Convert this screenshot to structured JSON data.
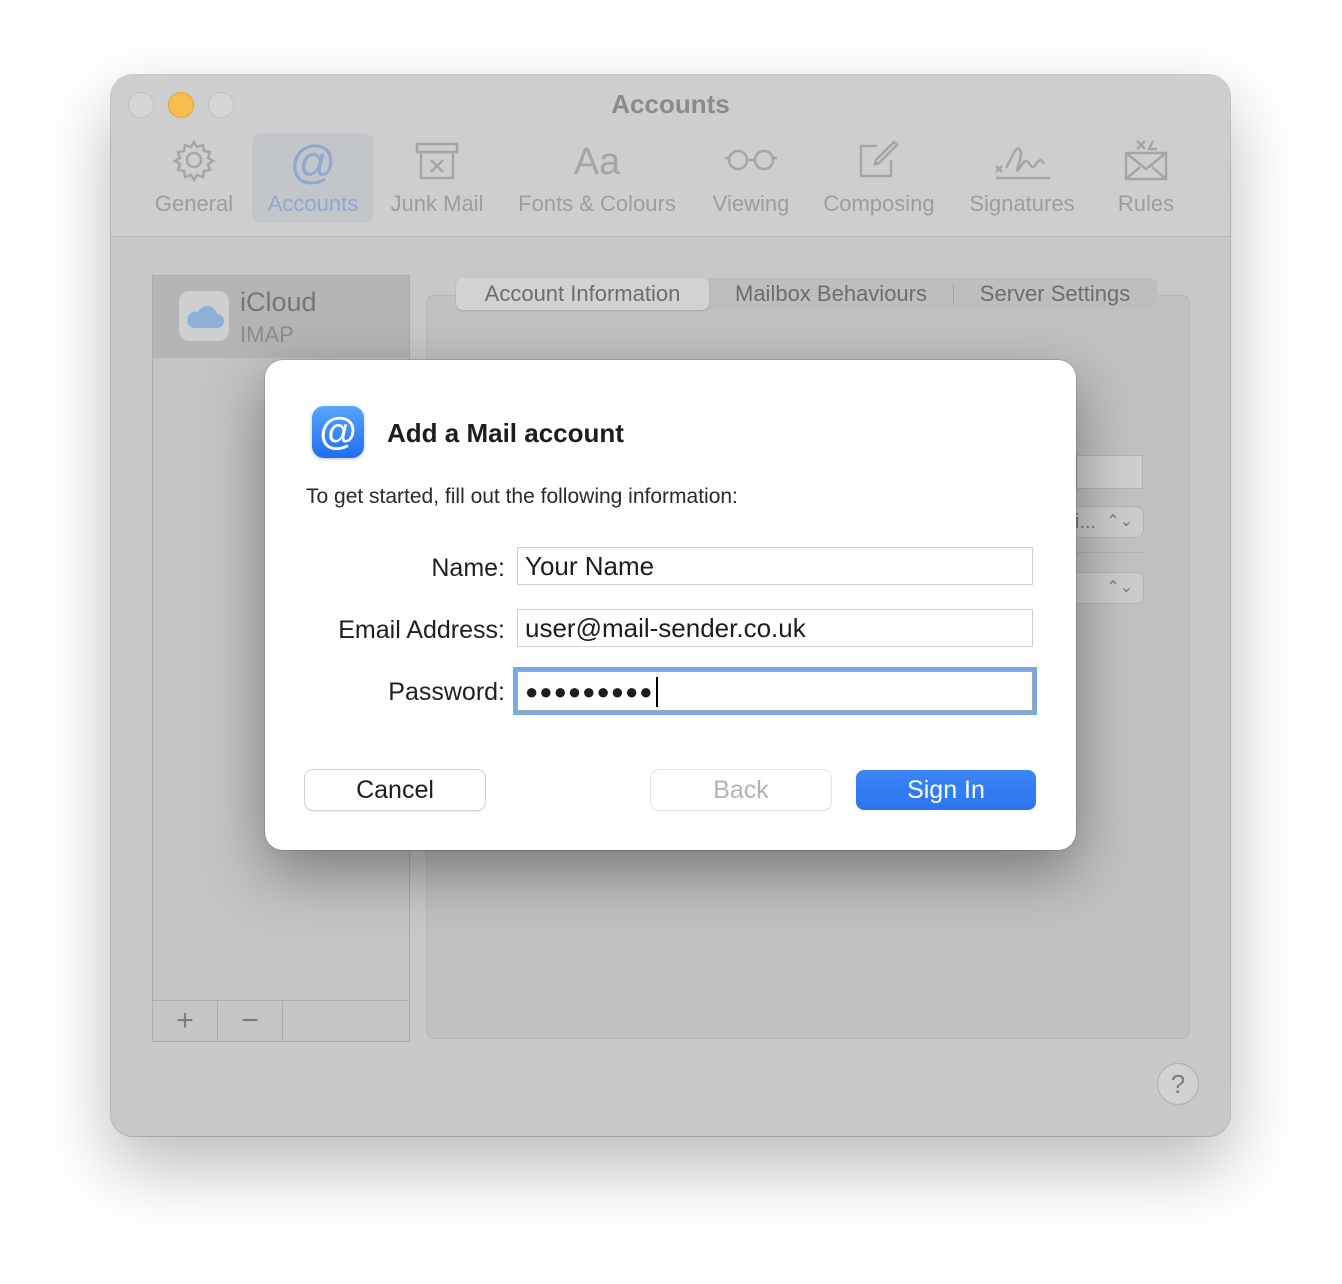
{
  "window": {
    "title": "Accounts"
  },
  "toolbar": {
    "items": [
      {
        "label": "General",
        "icon": "gear-icon"
      },
      {
        "label": "Accounts",
        "icon": "at-icon",
        "active": true
      },
      {
        "label": "Junk Mail",
        "icon": "junk-mail-icon"
      },
      {
        "label": "Fonts & Colours",
        "icon": "fonts-icon",
        "glyph": "Aa"
      },
      {
        "label": "Viewing",
        "icon": "glasses-icon"
      },
      {
        "label": "Composing",
        "icon": "compose-icon"
      },
      {
        "label": "Signatures",
        "icon": "signature-icon"
      },
      {
        "label": "Rules",
        "icon": "rules-icon"
      }
    ]
  },
  "sidebar": {
    "accounts": [
      {
        "name": "iCloud",
        "type": "IMAP",
        "icon": "cloud-icon"
      }
    ],
    "add_label": "+",
    "remove_label": "−"
  },
  "tabs": [
    {
      "label": "Account Information",
      "selected": true
    },
    {
      "label": "Mailbox Behaviours"
    },
    {
      "label": "Server Settings"
    }
  ],
  "background_popup": {
    "partial_text": "i..."
  },
  "help": {
    "label": "?"
  },
  "dialog": {
    "icon_glyph": "@",
    "title": "Add a Mail account",
    "subtitle": "To get started, fill out the following information:",
    "fields": {
      "name": {
        "label": "Name:",
        "value": "Your Name"
      },
      "email": {
        "label": "Email Address:",
        "value": "user@mail-sender.co.uk"
      },
      "password": {
        "label": "Password:",
        "value": "●●●●●●●●●"
      }
    },
    "buttons": {
      "cancel": "Cancel",
      "back": "Back",
      "sign_in": "Sign In"
    }
  },
  "colors": {
    "accent": "#2f7cf6",
    "focus_ring": "#7aa7ea",
    "minimize": "#f7bd4f"
  }
}
